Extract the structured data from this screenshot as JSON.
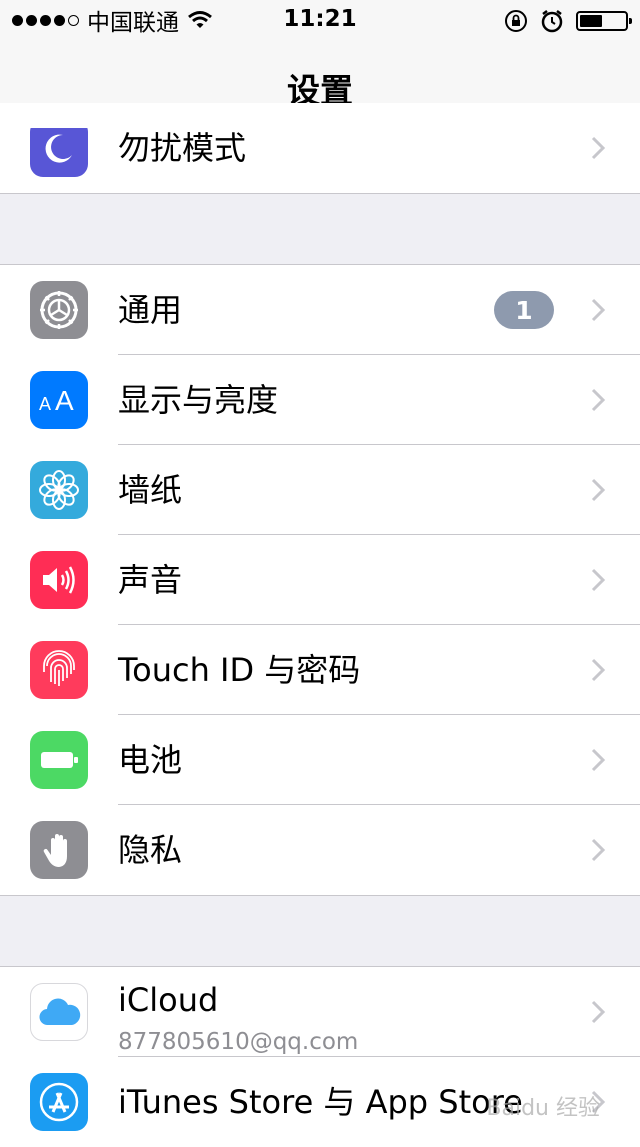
{
  "status_bar": {
    "carrier": "中国联通",
    "time": "11:21",
    "signal_icon": "signal-dots",
    "wifi_icon": "wifi-icon",
    "lock_icon": "orientation-lock-icon",
    "alarm_icon": "alarm-icon",
    "battery_icon": "battery-icon"
  },
  "nav": {
    "title": "设置"
  },
  "groups": [
    {
      "items": [
        {
          "label": "勿扰模式",
          "icon": "moon-icon",
          "color": "#5856d6"
        }
      ]
    },
    {
      "items": [
        {
          "label": "通用",
          "icon": "gear-icon",
          "color": "#8e8e93",
          "badge": "1"
        },
        {
          "label": "显示与亮度",
          "icon": "text-size-icon",
          "color": "#007aff"
        },
        {
          "label": "墙纸",
          "icon": "flower-icon",
          "color": "#34aadc"
        },
        {
          "label": "声音",
          "icon": "speaker-icon",
          "color": "#ff2d55"
        },
        {
          "label": "Touch ID 与密码",
          "icon": "fingerprint-icon",
          "color": "#ff3b5c"
        },
        {
          "label": "电池",
          "icon": "battery-icon",
          "color": "#4cd964"
        },
        {
          "label": "隐私",
          "icon": "hand-icon",
          "color": "#8e8e93"
        }
      ]
    },
    {
      "items": [
        {
          "label": "iCloud",
          "sub": "877805610@qq.com",
          "icon": "cloud-icon",
          "color": "#ffffff"
        },
        {
          "label": "iTunes Store 与 App Store",
          "icon": "app-store-icon",
          "color": "#1b9cf2"
        }
      ]
    }
  ],
  "watermark": "Baidu 经验"
}
